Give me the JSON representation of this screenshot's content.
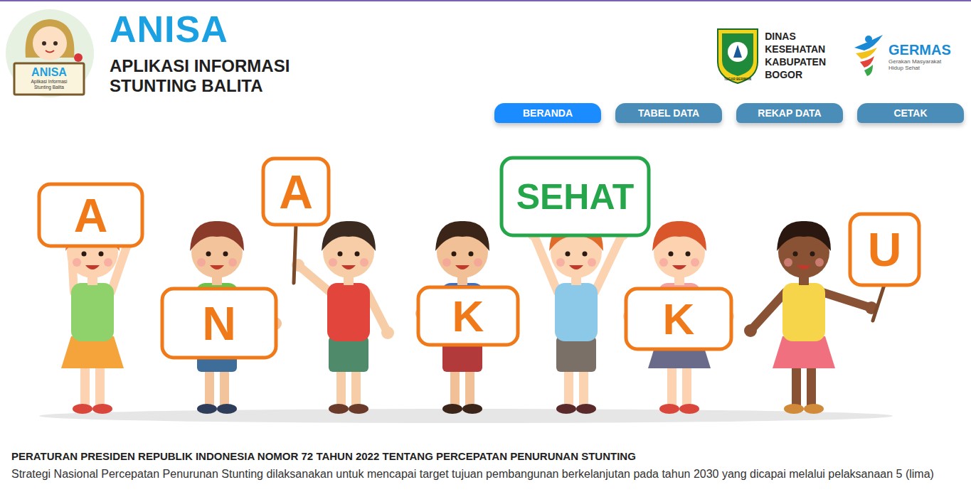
{
  "header": {
    "logo_badge": {
      "title": "ANISA",
      "tagline_lines": [
        "Aplikasi Informasi",
        "Stunting Balita"
      ]
    },
    "title": "ANISA",
    "subtitle_lines": [
      "APLIKASI INFORMASI",
      "STUNTING BALITA"
    ]
  },
  "agency": {
    "name_lines": [
      "DINAS",
      "KESEHATAN",
      "KABUPATEN",
      "BOGOR"
    ],
    "crest_motto": "TEGAR BERIMAN"
  },
  "germas": {
    "title": "GERMAS",
    "tagline_lines": [
      "Gerakan Masyarakat",
      "Hidup Sehat"
    ]
  },
  "nav": [
    {
      "label": "BERANDA",
      "selected": true
    },
    {
      "label": "TABEL DATA",
      "selected": false
    },
    {
      "label": "REKAP DATA",
      "selected": false
    },
    {
      "label": "CETAK",
      "selected": false
    }
  ],
  "hero": {
    "signs": [
      {
        "text": "A",
        "color": "#f07a1a"
      },
      {
        "text": "A",
        "color": "#f07a1a"
      },
      {
        "text": "N",
        "color": "#f07a1a"
      },
      {
        "text": "K",
        "color": "#f07a1a"
      },
      {
        "text": "SEHAT",
        "color": "#26a64a"
      },
      {
        "text": "K",
        "color": "#f07a1a"
      },
      {
        "text": "U",
        "color": "#f07a1a"
      }
    ]
  },
  "article": {
    "heading": "PERATURAN PRESIDEN REPUBLIK INDONESIA NOMOR 72 TAHUN 2022 TENTANG PERCEPATAN PENURUNAN STUNTING",
    "paragraph": "Strategi Nasional Percepatan Penurunan Stunting dilaksanakan untuk mencapai target tujuan pembangunan berkelanjutan pada tahun 2030 yang dicapai melalui pelaksanaan 5 (lima)"
  }
}
